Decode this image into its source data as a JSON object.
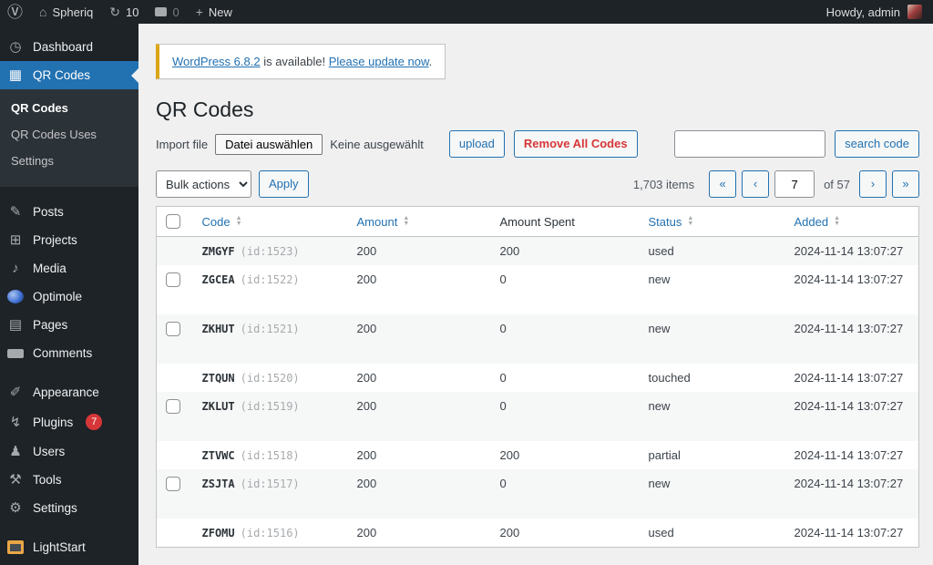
{
  "colors": {
    "accent": "#2271b1",
    "danger": "#d63638",
    "notice_yellow": "#dba617",
    "admin_dark": "#1d2327"
  },
  "admin_bar": {
    "site_name": "Spheriq",
    "update_count": "10",
    "comment_count": "0",
    "new_label": "New",
    "howdy": "Howdy, admin"
  },
  "sidebar": {
    "items": [
      {
        "key": "dashboard",
        "label": "Dashboard",
        "glyph": "◷"
      },
      {
        "key": "qr-codes",
        "label": "QR Codes",
        "glyph": "▦",
        "active": true,
        "submenu": [
          {
            "label": "QR Codes",
            "current": true
          },
          {
            "label": "QR Codes Uses"
          },
          {
            "label": "Settings"
          }
        ]
      },
      {
        "separator": true
      },
      {
        "key": "posts",
        "label": "Posts",
        "glyph": "✎"
      },
      {
        "key": "projects",
        "label": "Projects",
        "glyph": "⊞"
      },
      {
        "key": "media",
        "label": "Media",
        "glyph": "♪"
      },
      {
        "key": "optimole",
        "label": "Optimole",
        "icon_class": "icon-optimole"
      },
      {
        "key": "pages",
        "label": "Pages",
        "glyph": "▤"
      },
      {
        "key": "comments",
        "label": "Comments",
        "icon_class": "bubble"
      },
      {
        "separator": true
      },
      {
        "key": "appearance",
        "label": "Appearance",
        "glyph": "✐"
      },
      {
        "key": "plugins",
        "label": "Plugins",
        "glyph": "↯",
        "badge": "7"
      },
      {
        "key": "users",
        "label": "Users",
        "glyph": "♟"
      },
      {
        "key": "tools",
        "label": "Tools",
        "glyph": "⚒"
      },
      {
        "key": "settings",
        "label": "Settings",
        "glyph": "⚙"
      },
      {
        "separator": true
      },
      {
        "key": "lightstart",
        "label": "LightStart",
        "icon_class": "icon-lightstart"
      }
    ]
  },
  "notice": {
    "update_link": "WordPress 6.8.2",
    "middle": " is available! ",
    "action_link": "Please update now",
    "suffix": "."
  },
  "page": {
    "title": "QR Codes",
    "import_label": "Import file",
    "file_button": "Datei auswählen",
    "file_status": "Keine ausgewählt",
    "upload_button": "upload",
    "remove_all_button": "Remove All Codes",
    "search_button": "search code",
    "search_value": ""
  },
  "toolbar": {
    "bulk_actions_label": "Bulk actions",
    "apply_label": "Apply",
    "items_count": "1,703 items",
    "first_page": "«",
    "prev_page": "‹",
    "current_page": "7",
    "of_label": "of 57",
    "next_page": "›",
    "last_page": "»"
  },
  "table": {
    "headers": [
      {
        "label": "Code",
        "sortable": true
      },
      {
        "label": "Amount",
        "sortable": true
      },
      {
        "label": "Amount Spent",
        "sortable": false
      },
      {
        "label": "Status",
        "sortable": true
      },
      {
        "label": "Added",
        "sortable": true
      }
    ],
    "rows": [
      {
        "code": "ZMGYF",
        "id": "(id:1523)",
        "amount": "200",
        "amount_spent": "200",
        "status": "used",
        "added": "2024-11-14 13:07:27",
        "selectable": false
      },
      {
        "code": "ZGCEA",
        "id": "(id:1522)",
        "amount": "200",
        "amount_spent": "0",
        "status": "new",
        "added": "2024-11-14 13:07:27",
        "selectable": true
      },
      {
        "code": "ZKHUT",
        "id": "(id:1521)",
        "amount": "200",
        "amount_spent": "0",
        "status": "new",
        "added": "2024-11-14 13:07:27",
        "selectable": true
      },
      {
        "code": "ZTQUN",
        "id": "(id:1520)",
        "amount": "200",
        "amount_spent": "0",
        "status": "touched",
        "added": "2024-11-14 13:07:27",
        "selectable": false
      },
      {
        "code": "ZKLUT",
        "id": "(id:1519)",
        "amount": "200",
        "amount_spent": "0",
        "status": "new",
        "added": "2024-11-14 13:07:27",
        "selectable": true
      },
      {
        "code": "ZTVWC",
        "id": "(id:1518)",
        "amount": "200",
        "amount_spent": "200",
        "status": "partial",
        "added": "2024-11-14 13:07:27",
        "selectable": false
      },
      {
        "code": "ZSJTA",
        "id": "(id:1517)",
        "amount": "200",
        "amount_spent": "0",
        "status": "new",
        "added": "2024-11-14 13:07:27",
        "selectable": true
      },
      {
        "code": "ZFOMU",
        "id": "(id:1516)",
        "amount": "200",
        "amount_spent": "200",
        "status": "used",
        "added": "2024-11-14 13:07:27",
        "selectable": false
      }
    ]
  }
}
